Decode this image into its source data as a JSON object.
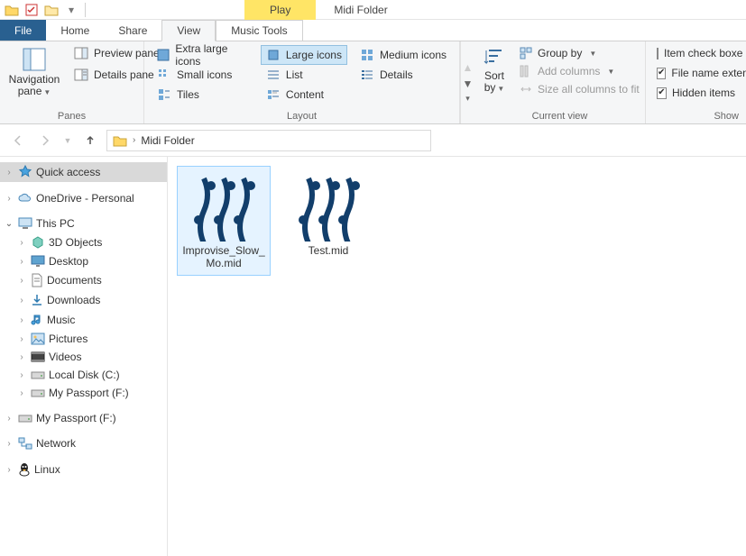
{
  "contextTab": {
    "play": "Play",
    "title": "Midi Folder"
  },
  "tabs": {
    "file": "File",
    "home": "Home",
    "share": "Share",
    "view": "View",
    "musicTools": "Music Tools"
  },
  "ribbon": {
    "panes": {
      "navigation": "Navigation pane",
      "preview": "Preview pane",
      "details": "Details pane",
      "title": "Panes"
    },
    "layout": {
      "xlarge": "Extra large icons",
      "large": "Large icons",
      "medium": "Medium icons",
      "small": "Small icons",
      "list": "List",
      "details": "Details",
      "tiles": "Tiles",
      "content": "Content",
      "title": "Layout"
    },
    "current": {
      "sortBy": "Sort by",
      "groupBy": "Group by",
      "addColumns": "Add columns",
      "sizeAll": "Size all columns to fit",
      "title": "Current view"
    },
    "showhide": {
      "itemCheck": "Item check boxe",
      "fileExt": "File name extens",
      "hidden": "Hidden items",
      "title": "Show"
    }
  },
  "breadcrumb": {
    "folder": "Midi Folder"
  },
  "tree": {
    "quickAccess": "Quick access",
    "onedrive": "OneDrive - Personal",
    "thisPC": "This PC",
    "objects3d": "3D Objects",
    "desktop": "Desktop",
    "documents": "Documents",
    "downloads": "Downloads",
    "music": "Music",
    "pictures": "Pictures",
    "videos": "Videos",
    "localDisk": "Local Disk (C:)",
    "passportF1": "My Passport (F:)",
    "passportF2": "My Passport (F:)",
    "network": "Network",
    "linux": "Linux"
  },
  "files": {
    "f1": "Improvise_Slow_Mo.mid",
    "f2": "Test.mid"
  }
}
